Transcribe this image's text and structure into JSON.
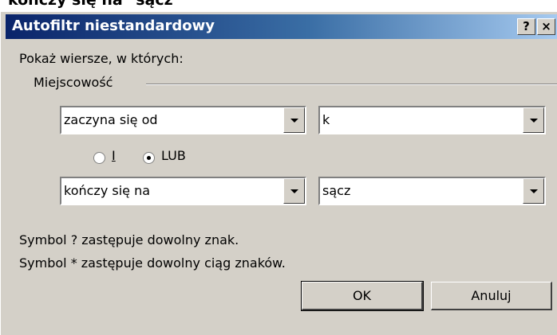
{
  "caption": "kończy się na \"sącz\"",
  "dialog": {
    "title": "Autofiltr niestandardowy",
    "help_label": "?",
    "close_label": "×",
    "show_rows_label": "Pokaż wiersze, w których:",
    "field_name": "Miejscowość",
    "criterion1": {
      "operator": "zaczyna się od",
      "value": "k"
    },
    "logic": {
      "and_label": "I",
      "or_label": "LUB",
      "selected": "LUB"
    },
    "criterion2": {
      "operator": "kończy się na",
      "value": "sącz"
    },
    "hint1": "Symbol ? zastępuje dowolny znak.",
    "hint2": "Symbol * zastępuje dowolny ciąg znaków.",
    "ok_label": "OK",
    "cancel_label": "Anuluj"
  }
}
